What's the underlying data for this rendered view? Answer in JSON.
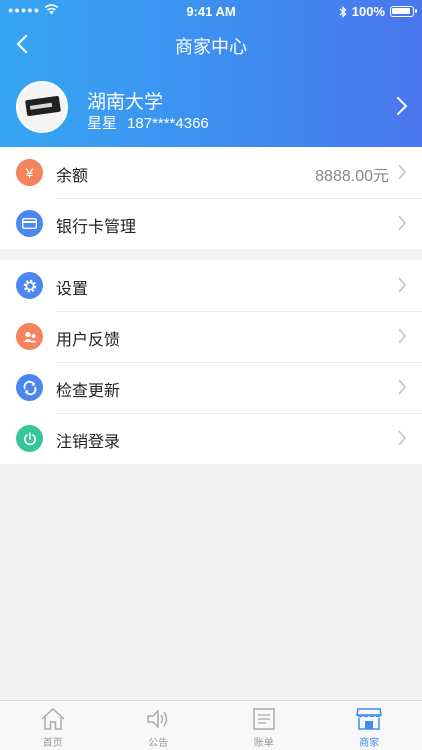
{
  "status_bar": {
    "time": "9:41 AM",
    "battery": "100%"
  },
  "nav": {
    "title": "商家中心"
  },
  "profile": {
    "name": "湖南大学",
    "user": "星星",
    "phone": "187****4366"
  },
  "balance": {
    "label": "余额",
    "value": "8888.00元",
    "icon_char": "¥"
  },
  "bank": {
    "label": "银行卡管理"
  },
  "menu": [
    {
      "label": "设置",
      "icon": "gear-icon"
    },
    {
      "label": "用户反馈",
      "icon": "feedback-icon"
    },
    {
      "label": "检查更新",
      "icon": "refresh-icon"
    },
    {
      "label": "注销登录",
      "icon": "power-icon"
    }
  ],
  "tabs": [
    {
      "label": "首页",
      "icon": "home-icon"
    },
    {
      "label": "公告",
      "icon": "speaker-icon"
    },
    {
      "label": "账单",
      "icon": "bill-icon"
    },
    {
      "label": "商家",
      "icon": "shop-icon"
    }
  ],
  "colors": {
    "header_start": "#36a6f2",
    "header_end": "#4a76ee",
    "balance_icon": "#f3845e",
    "bank_icon": "#4a87f0",
    "settings_icon": "#4a87f0",
    "feedback_icon": "#f3845e",
    "update_icon": "#4a87f0",
    "logout_icon": "#37c59c",
    "tab_active": "#3a8df0"
  }
}
